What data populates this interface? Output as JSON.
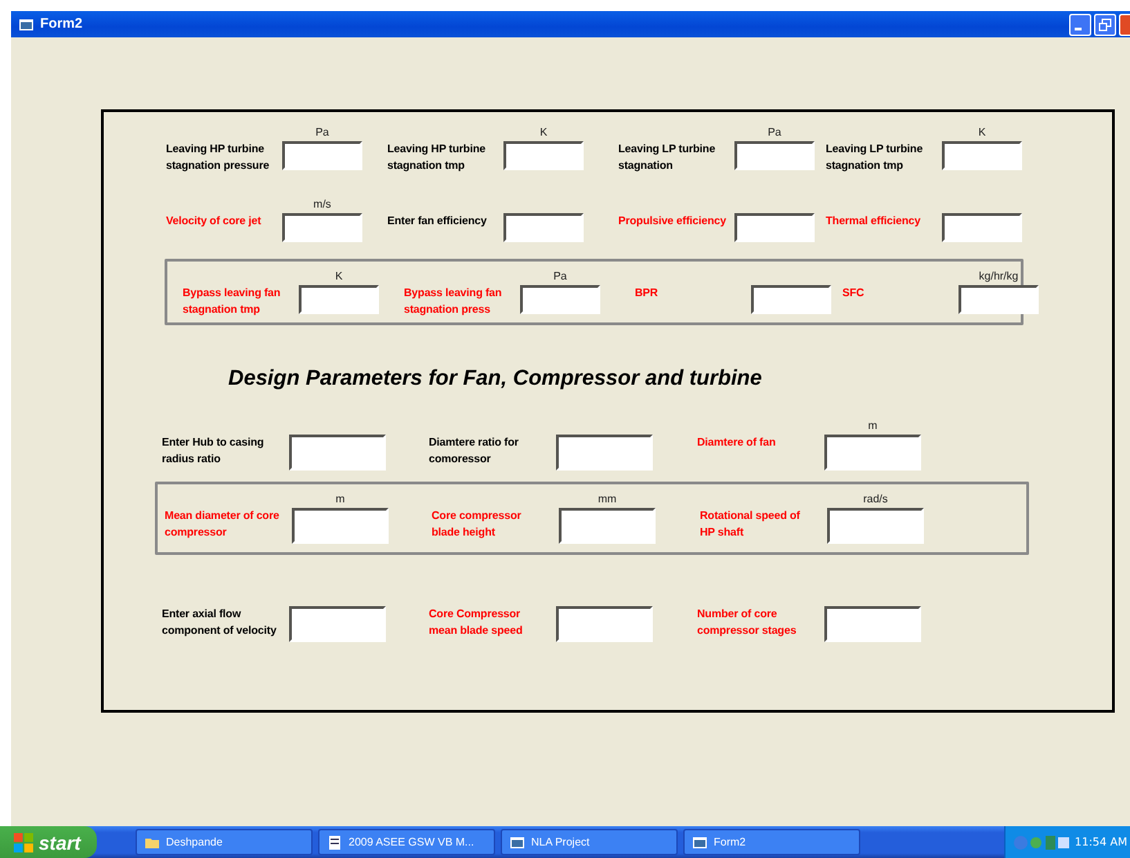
{
  "window": {
    "title": "Form2"
  },
  "sections": [
    {
      "kind": "fields",
      "boxed": false,
      "rows": [
        [
          {
            "label": "Leaving HP turbine stagnation pressure",
            "unit": "Pa",
            "color": "#000000"
          },
          {
            "label": "Leaving HP turbine stagnation tmp",
            "unit": "K",
            "color": "#000000"
          },
          {
            "label": "Leaving LP turbine stagnation",
            "unit": "Pa",
            "color": "#000000"
          },
          {
            "label": "Leaving LP turbine stagnation tmp",
            "unit": "K",
            "color": "#000000"
          }
        ],
        [
          {
            "label": "Velocity of core jet",
            "unit": "m/s",
            "color": "#ff0000"
          },
          {
            "label": "Enter fan efficiency",
            "color": "#000000"
          },
          {
            "label": "Propulsive efficiency",
            "color": "#ff0000"
          },
          {
            "label": "Thermal efficiency",
            "color": "#ff0000"
          }
        ]
      ]
    },
    {
      "kind": "fields",
      "boxed": true,
      "rows": [
        [
          {
            "label": "Bypass leaving fan stagnation tmp",
            "unit": "K",
            "color": "#ff0000"
          },
          {
            "label": "Bypass leaving fan stagnation press",
            "unit": "Pa",
            "color": "#ff0000"
          },
          {
            "label": "BPR",
            "color": "#ff0000"
          },
          {
            "label": "SFC",
            "unit": "kg/hr/kg",
            "color": "#ff0000"
          }
        ]
      ]
    },
    {
      "kind": "heading",
      "text": "Design Parameters for Fan, Compressor and turbine"
    },
    {
      "kind": "fields",
      "boxed": false,
      "rows": [
        [
          {
            "label": "Enter Hub to casing radius ratio",
            "color": "#000000"
          },
          {
            "label": "Diamtere ratio for comoressor",
            "color": "#000000"
          },
          {
            "label": "Diamtere of fan",
            "unit": "m",
            "color": "#ff0000"
          }
        ]
      ]
    },
    {
      "kind": "fields",
      "boxed": true,
      "rows": [
        [
          {
            "label": "Mean diameter of core compressor",
            "unit": "m",
            "color": "#ff0000"
          },
          {
            "label": "Core compressor blade height",
            "unit": "mm",
            "color": "#ff0000"
          },
          {
            "label": "Rotational speed of HP shaft",
            "unit": "rad/s",
            "color": "#ff0000"
          }
        ]
      ]
    },
    {
      "kind": "fields",
      "boxed": false,
      "rows": [
        [
          {
            "label": "Enter axial flow component of velocity",
            "color": "#000000"
          },
          {
            "label": "Core Compressor mean blade speed",
            "color": "#ff0000"
          },
          {
            "label": "Number of core compressor stages",
            "color": "#ff0000"
          }
        ]
      ]
    }
  ],
  "taskbar": {
    "start": "start",
    "tasks": [
      {
        "label": "Deshpande",
        "kind": "folder"
      },
      {
        "label": "2009 ASEE GSW VB M...",
        "kind": "document"
      },
      {
        "label": "NLA Project",
        "kind": "app"
      },
      {
        "label": "Form2",
        "kind": "app"
      }
    ],
    "clock": "11:54 AM"
  }
}
